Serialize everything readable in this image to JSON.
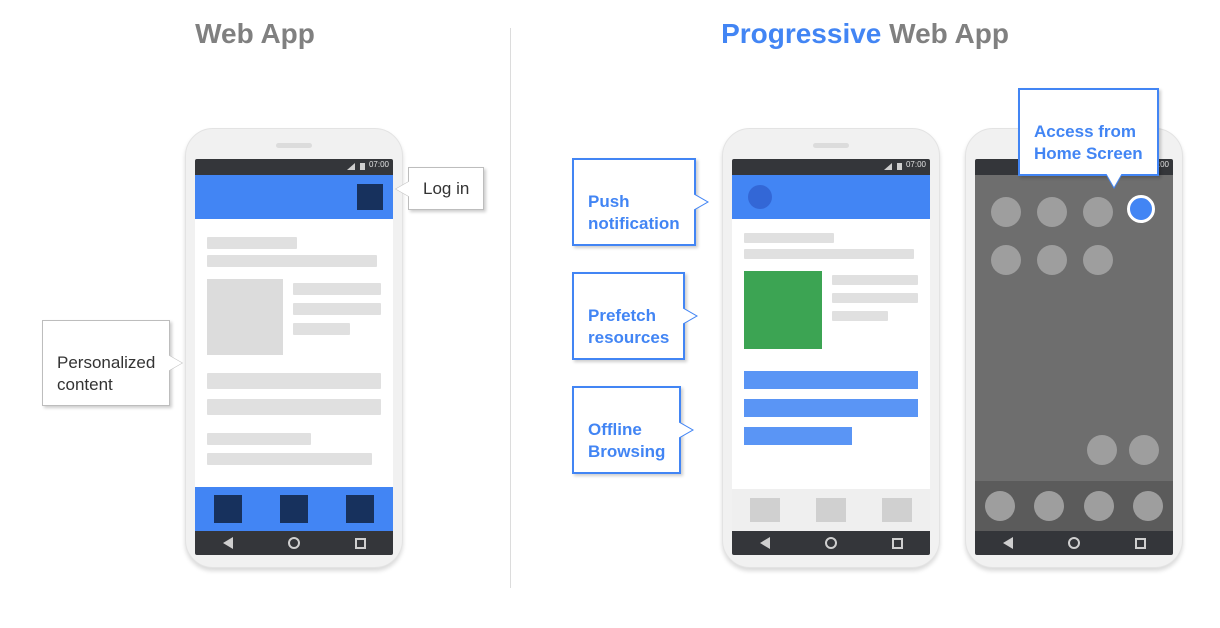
{
  "left": {
    "heading": "Web App",
    "callouts": {
      "login": "Log in",
      "personalized": "Personalized\ncontent"
    },
    "status_time": "07:00"
  },
  "right": {
    "heading_accent": "Progressive",
    "heading_rest": " Web App",
    "callouts": {
      "push": "Push\nnotification",
      "prefetch": "Prefetch\nresources",
      "offline": "Offline\nBrowsing",
      "home": "Access from\nHome Screen"
    },
    "status_time": "07:00"
  }
}
